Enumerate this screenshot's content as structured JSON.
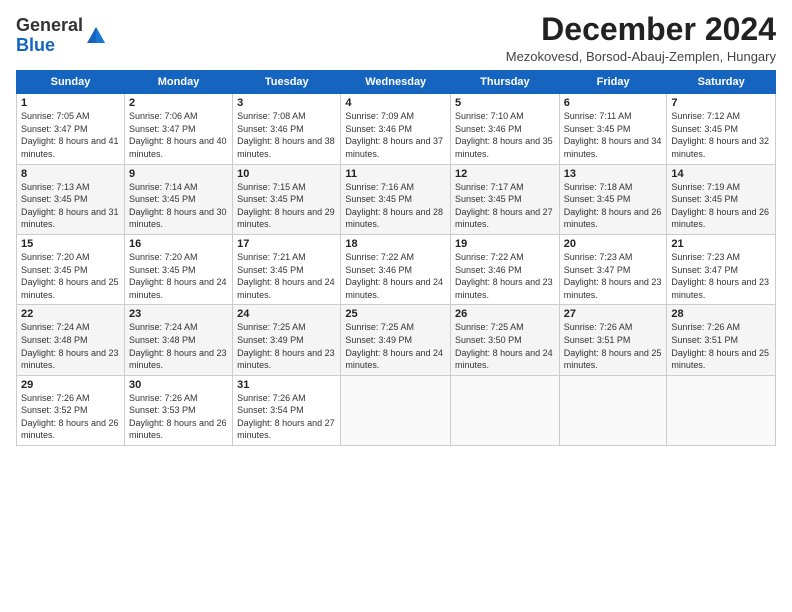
{
  "header": {
    "logo_general": "General",
    "logo_blue": "Blue",
    "main_title": "December 2024",
    "subtitle": "Mezokovesd, Borsod-Abauj-Zemplen, Hungary"
  },
  "weekdays": [
    "Sunday",
    "Monday",
    "Tuesday",
    "Wednesday",
    "Thursday",
    "Friday",
    "Saturday"
  ],
  "weeks": [
    [
      {
        "day": "1",
        "sunrise": "Sunrise: 7:05 AM",
        "sunset": "Sunset: 3:47 PM",
        "daylight": "Daylight: 8 hours and 41 minutes."
      },
      {
        "day": "2",
        "sunrise": "Sunrise: 7:06 AM",
        "sunset": "Sunset: 3:47 PM",
        "daylight": "Daylight: 8 hours and 40 minutes."
      },
      {
        "day": "3",
        "sunrise": "Sunrise: 7:08 AM",
        "sunset": "Sunset: 3:46 PM",
        "daylight": "Daylight: 8 hours and 38 minutes."
      },
      {
        "day": "4",
        "sunrise": "Sunrise: 7:09 AM",
        "sunset": "Sunset: 3:46 PM",
        "daylight": "Daylight: 8 hours and 37 minutes."
      },
      {
        "day": "5",
        "sunrise": "Sunrise: 7:10 AM",
        "sunset": "Sunset: 3:46 PM",
        "daylight": "Daylight: 8 hours and 35 minutes."
      },
      {
        "day": "6",
        "sunrise": "Sunrise: 7:11 AM",
        "sunset": "Sunset: 3:45 PM",
        "daylight": "Daylight: 8 hours and 34 minutes."
      },
      {
        "day": "7",
        "sunrise": "Sunrise: 7:12 AM",
        "sunset": "Sunset: 3:45 PM",
        "daylight": "Daylight: 8 hours and 32 minutes."
      }
    ],
    [
      {
        "day": "8",
        "sunrise": "Sunrise: 7:13 AM",
        "sunset": "Sunset: 3:45 PM",
        "daylight": "Daylight: 8 hours and 31 minutes."
      },
      {
        "day": "9",
        "sunrise": "Sunrise: 7:14 AM",
        "sunset": "Sunset: 3:45 PM",
        "daylight": "Daylight: 8 hours and 30 minutes."
      },
      {
        "day": "10",
        "sunrise": "Sunrise: 7:15 AM",
        "sunset": "Sunset: 3:45 PM",
        "daylight": "Daylight: 8 hours and 29 minutes."
      },
      {
        "day": "11",
        "sunrise": "Sunrise: 7:16 AM",
        "sunset": "Sunset: 3:45 PM",
        "daylight": "Daylight: 8 hours and 28 minutes."
      },
      {
        "day": "12",
        "sunrise": "Sunrise: 7:17 AM",
        "sunset": "Sunset: 3:45 PM",
        "daylight": "Daylight: 8 hours and 27 minutes."
      },
      {
        "day": "13",
        "sunrise": "Sunrise: 7:18 AM",
        "sunset": "Sunset: 3:45 PM",
        "daylight": "Daylight: 8 hours and 26 minutes."
      },
      {
        "day": "14",
        "sunrise": "Sunrise: 7:19 AM",
        "sunset": "Sunset: 3:45 PM",
        "daylight": "Daylight: 8 hours and 26 minutes."
      }
    ],
    [
      {
        "day": "15",
        "sunrise": "Sunrise: 7:20 AM",
        "sunset": "Sunset: 3:45 PM",
        "daylight": "Daylight: 8 hours and 25 minutes."
      },
      {
        "day": "16",
        "sunrise": "Sunrise: 7:20 AM",
        "sunset": "Sunset: 3:45 PM",
        "daylight": "Daylight: 8 hours and 24 minutes."
      },
      {
        "day": "17",
        "sunrise": "Sunrise: 7:21 AM",
        "sunset": "Sunset: 3:45 PM",
        "daylight": "Daylight: 8 hours and 24 minutes."
      },
      {
        "day": "18",
        "sunrise": "Sunrise: 7:22 AM",
        "sunset": "Sunset: 3:46 PM",
        "daylight": "Daylight: 8 hours and 24 minutes."
      },
      {
        "day": "19",
        "sunrise": "Sunrise: 7:22 AM",
        "sunset": "Sunset: 3:46 PM",
        "daylight": "Daylight: 8 hours and 23 minutes."
      },
      {
        "day": "20",
        "sunrise": "Sunrise: 7:23 AM",
        "sunset": "Sunset: 3:47 PM",
        "daylight": "Daylight: 8 hours and 23 minutes."
      },
      {
        "day": "21",
        "sunrise": "Sunrise: 7:23 AM",
        "sunset": "Sunset: 3:47 PM",
        "daylight": "Daylight: 8 hours and 23 minutes."
      }
    ],
    [
      {
        "day": "22",
        "sunrise": "Sunrise: 7:24 AM",
        "sunset": "Sunset: 3:48 PM",
        "daylight": "Daylight: 8 hours and 23 minutes."
      },
      {
        "day": "23",
        "sunrise": "Sunrise: 7:24 AM",
        "sunset": "Sunset: 3:48 PM",
        "daylight": "Daylight: 8 hours and 23 minutes."
      },
      {
        "day": "24",
        "sunrise": "Sunrise: 7:25 AM",
        "sunset": "Sunset: 3:49 PM",
        "daylight": "Daylight: 8 hours and 23 minutes."
      },
      {
        "day": "25",
        "sunrise": "Sunrise: 7:25 AM",
        "sunset": "Sunset: 3:49 PM",
        "daylight": "Daylight: 8 hours and 24 minutes."
      },
      {
        "day": "26",
        "sunrise": "Sunrise: 7:25 AM",
        "sunset": "Sunset: 3:50 PM",
        "daylight": "Daylight: 8 hours and 24 minutes."
      },
      {
        "day": "27",
        "sunrise": "Sunrise: 7:26 AM",
        "sunset": "Sunset: 3:51 PM",
        "daylight": "Daylight: 8 hours and 25 minutes."
      },
      {
        "day": "28",
        "sunrise": "Sunrise: 7:26 AM",
        "sunset": "Sunset: 3:51 PM",
        "daylight": "Daylight: 8 hours and 25 minutes."
      }
    ],
    [
      {
        "day": "29",
        "sunrise": "Sunrise: 7:26 AM",
        "sunset": "Sunset: 3:52 PM",
        "daylight": "Daylight: 8 hours and 26 minutes."
      },
      {
        "day": "30",
        "sunrise": "Sunrise: 7:26 AM",
        "sunset": "Sunset: 3:53 PM",
        "daylight": "Daylight: 8 hours and 26 minutes."
      },
      {
        "day": "31",
        "sunrise": "Sunrise: 7:26 AM",
        "sunset": "Sunset: 3:54 PM",
        "daylight": "Daylight: 8 hours and 27 minutes."
      },
      null,
      null,
      null,
      null
    ]
  ]
}
